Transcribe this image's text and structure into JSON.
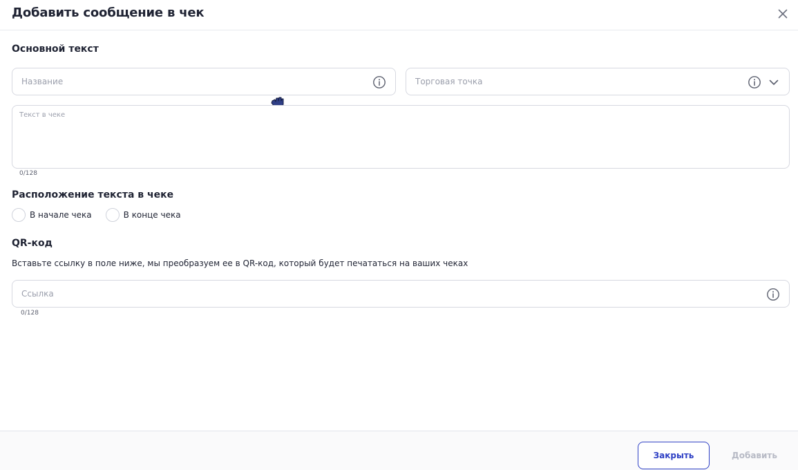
{
  "dialog": {
    "title": "Добавить сообщение в чек"
  },
  "main_text": {
    "heading": "Основной текст",
    "name_field": {
      "placeholder": "Название",
      "value": ""
    },
    "store_field": {
      "placeholder": "Торговая точка",
      "value": ""
    },
    "receipt_text": {
      "placeholder": "Текст в чеке",
      "value": "",
      "counter": "0/128"
    }
  },
  "position": {
    "heading": "Расположение текста в чеке",
    "options": [
      {
        "label": "В начале чека",
        "selected": false
      },
      {
        "label": "В конце чека",
        "selected": false
      }
    ]
  },
  "qr": {
    "heading": "QR-код",
    "description": "Вставьте ссылку в поле ниже, мы преобразуем ее в QR-код, который будет печататься на ваших чеках",
    "link_field": {
      "placeholder": "Ссылка",
      "value": "",
      "counter": "0/128"
    }
  },
  "footer": {
    "close_label": "Закрыть",
    "add_label": "Добавить"
  },
  "colors": {
    "accent": "#2d3fc4",
    "text": "#1f2333",
    "placeholder": "#9a9eab",
    "border": "#d6d8e0",
    "disabled": "#b7bac5"
  },
  "icons": [
    "close-icon",
    "info-icon",
    "chevron-down-icon",
    "hand-cursor-icon"
  ]
}
